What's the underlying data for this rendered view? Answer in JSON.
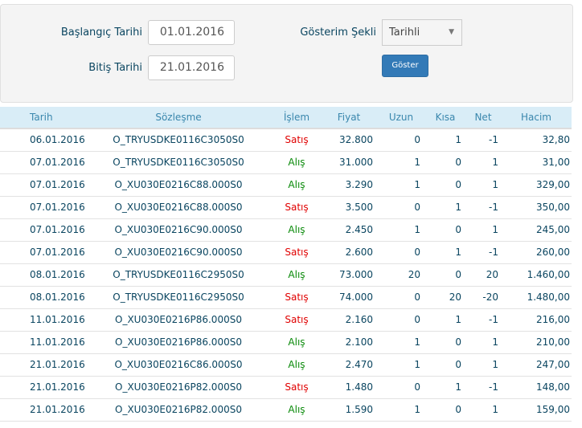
{
  "filters": {
    "start_label": "Başlangıç Tarihi",
    "start_value": "01.01.2016",
    "end_label": "Bitiş Tarihi",
    "end_value": "21.01.2016",
    "display_label": "Gösterim Şekli",
    "display_value": "Tarihli",
    "show_button": "Göster"
  },
  "table": {
    "headers": [
      "Tarih",
      "Sözleşme",
      "İşlem",
      "Fiyat",
      "Uzun",
      "Kısa",
      "Net",
      "Hacim"
    ],
    "rows": [
      [
        "06.01.2016",
        "O_TRYUSDKE0116C3050S0",
        "Satış",
        "32.800",
        "0",
        "1",
        "-1",
        "32,80"
      ],
      [
        "07.01.2016",
        "O_TRYUSDKE0116C3050S0",
        "Alış",
        "31.000",
        "1",
        "0",
        "1",
        "31,00"
      ],
      [
        "07.01.2016",
        "O_XU030E0216C88.000S0",
        "Alış",
        "3.290",
        "1",
        "0",
        "1",
        "329,00"
      ],
      [
        "07.01.2016",
        "O_XU030E0216C88.000S0",
        "Satış",
        "3.500",
        "0",
        "1",
        "-1",
        "350,00"
      ],
      [
        "07.01.2016",
        "O_XU030E0216C90.000S0",
        "Alış",
        "2.450",
        "1",
        "0",
        "1",
        "245,00"
      ],
      [
        "07.01.2016",
        "O_XU030E0216C90.000S0",
        "Satış",
        "2.600",
        "0",
        "1",
        "-1",
        "260,00"
      ],
      [
        "08.01.2016",
        "O_TRYUSDKE0116C2950S0",
        "Alış",
        "73.000",
        "20",
        "0",
        "20",
        "1.460,00"
      ],
      [
        "08.01.2016",
        "O_TRYUSDKE0116C2950S0",
        "Satış",
        "74.000",
        "0",
        "20",
        "-20",
        "1.480,00"
      ],
      [
        "11.01.2016",
        "O_XU030E0216P86.000S0",
        "Satış",
        "2.160",
        "0",
        "1",
        "-1",
        "216,00"
      ],
      [
        "11.01.2016",
        "O_XU030E0216P86.000S0",
        "Alış",
        "2.100",
        "1",
        "0",
        "1",
        "210,00"
      ],
      [
        "21.01.2016",
        "O_XU030E0216C86.000S0",
        "Alış",
        "2.470",
        "1",
        "0",
        "1",
        "247,00"
      ],
      [
        "21.01.2016",
        "O_XU030E0216P82.000S0",
        "Satış",
        "1.480",
        "0",
        "1",
        "-1",
        "148,00"
      ],
      [
        "21.01.2016",
        "O_XU030E0216P82.000S0",
        "Alış",
        "1.590",
        "1",
        "0",
        "1",
        "159,00"
      ]
    ]
  },
  "colors": {
    "header_bg": "#d9edf7",
    "sell": "#e00000",
    "buy": "#0a8a0a",
    "button": "#337ab7"
  }
}
